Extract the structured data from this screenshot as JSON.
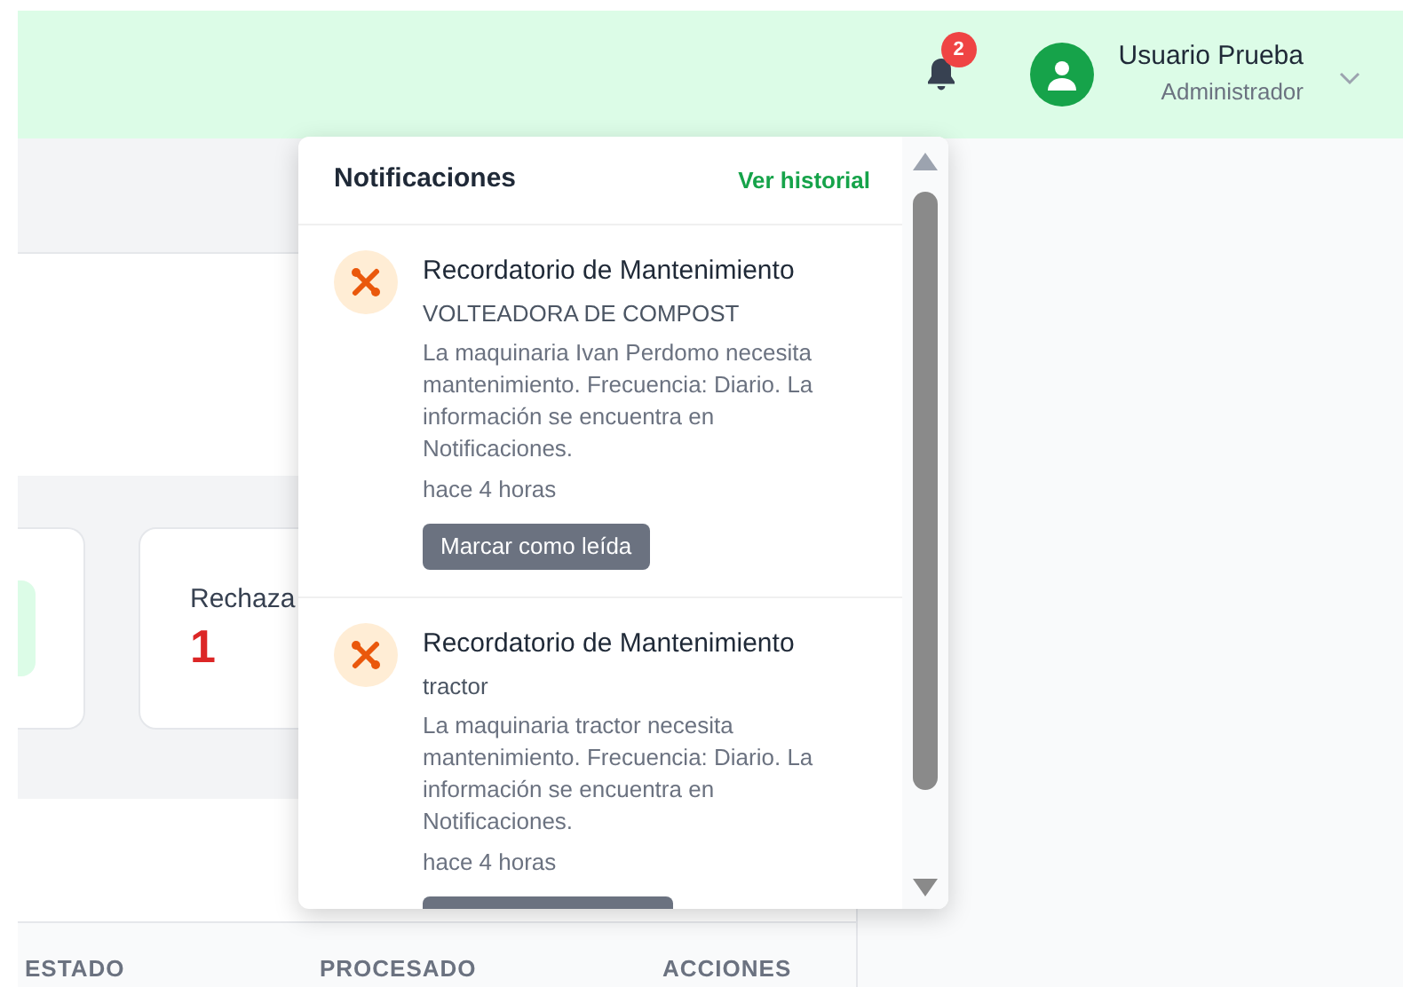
{
  "header": {
    "notification_count": "2",
    "user": {
      "name": "Usuario Prueba",
      "role": "Administrador"
    }
  },
  "summary_cards": [
    {
      "label": "Rechaza",
      "value": "1"
    }
  ],
  "table": {
    "columns": [
      "ESTADO",
      "PROCESADO",
      "ACCIONES"
    ]
  },
  "notifications": {
    "title": "Notificaciones",
    "history_link": "Ver historial",
    "items": [
      {
        "title": "Recordatorio de Mantenimiento",
        "subject": "VOLTEADORA DE COMPOST",
        "message": "La maquinaria Ivan Perdomo necesita mantenimiento. Frecuencia: Diario. La información se encuentra en Notificaciones.",
        "time": "hace 4 horas",
        "action": "Marcar como leída"
      },
      {
        "title": "Recordatorio de Mantenimiento",
        "subject": "tractor",
        "message": "La maquinaria tractor necesita mantenimiento. Frecuencia: Diario. La información se encuentra en Notificaciones.",
        "time": "hace 4 horas",
        "action_cut_off": true
      }
    ]
  }
}
